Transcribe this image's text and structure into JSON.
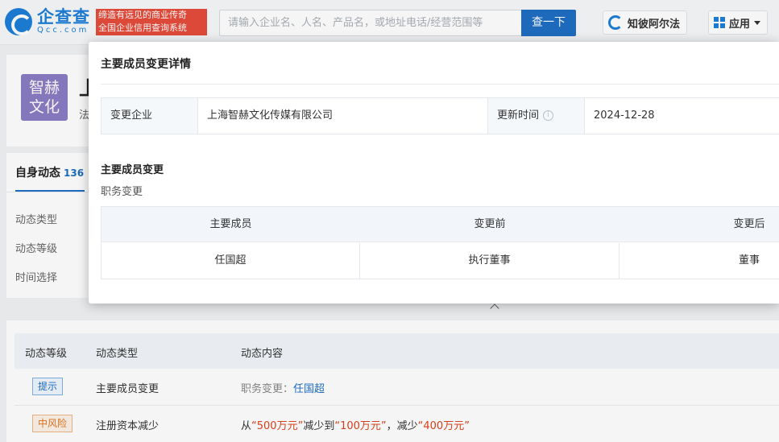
{
  "header": {
    "logo_cn": "企查查",
    "logo_en": "Qcc.com",
    "slogan_line1": "缔造有远见的商业传奇",
    "slogan_line2": "全国企业信用查询系统",
    "search_placeholder": "请输入企业名、人名、产品名，或地址电话/经营范围等",
    "search_button": "查一下",
    "zhibi_label": "知彼阿尔法",
    "apps_label": "应用"
  },
  "company": {
    "logo_line1": "智赫",
    "logo_line2": "文化",
    "name_stub": "上",
    "sub_stub": "法"
  },
  "left_panel": {
    "tab_label": "自身动态",
    "tab_count": "136",
    "filters": [
      "动态类型",
      "动态等级",
      "时间选择"
    ]
  },
  "bg_table": {
    "headers": [
      "动态等级",
      "动态类型",
      "动态内容"
    ],
    "rows": [
      {
        "level": "提示",
        "type": "主要成员变更",
        "content_prefix": "职务变更：",
        "content_link": "任国超"
      },
      {
        "level": "中风险",
        "type": "注册资本减少",
        "content_from": "从",
        "amount_before": "“500万元”",
        "content_mid": "减少到",
        "amount_after": "“100万元”",
        "content_sep": "，减少",
        "amount_diff": "“400万元”"
      }
    ]
  },
  "modal": {
    "title": "主要成员变更详情",
    "info": {
      "company_label": "变更企业",
      "company_value": "上海智赫文化传媒有限公司",
      "update_label": "更新时间",
      "update_value": "2024-12-28"
    },
    "section_title": "主要成员变更",
    "section_sub": "职务变更",
    "table": {
      "headers": [
        "主要成员",
        "变更前",
        "变更后"
      ],
      "rows": [
        {
          "member": "任国超",
          "before": "执行董事",
          "after": "董事"
        }
      ]
    }
  },
  "colors": {
    "brand_blue": "#1d7fd8",
    "link_blue": "#1f6fc4",
    "risk_orange": "#e0761f",
    "amount_red": "#e0421f",
    "slogan_red": "#e74c3c"
  }
}
